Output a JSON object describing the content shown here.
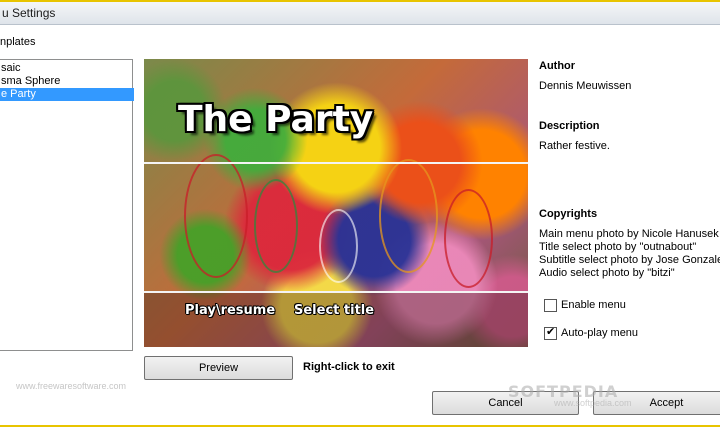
{
  "window": {
    "title": "u Settings"
  },
  "templates": {
    "label": "nplates",
    "items": [
      {
        "label": "saic",
        "selected": false
      },
      {
        "label": "sma Sphere",
        "selected": false
      },
      {
        "label": "e Party",
        "selected": true
      }
    ]
  },
  "preview": {
    "title": "The Party",
    "menu_items": [
      "Play\\resume",
      "Select title"
    ]
  },
  "info": {
    "author_heading": "Author",
    "author": "Dennis Meuwissen",
    "description_heading": "Description",
    "description": "Rather festive.",
    "copyrights_heading": "Copyrights",
    "copyrights": [
      "Main menu photo by Nicole Hanusek",
      "Title select photo by \"outnabout\"",
      "Subtitle select photo by Jose Gonzalez",
      "Audio select photo by \"bitzi\""
    ]
  },
  "options": {
    "enable_menu": {
      "label": "Enable menu",
      "checked": false
    },
    "autoplay_menu": {
      "label": "Auto-play menu",
      "checked": true
    }
  },
  "buttons": {
    "preview": "Preview",
    "cancel": "Cancel",
    "accept": "Accept"
  },
  "hint": "Right-click to exit",
  "watermark": {
    "site": "www.freewaresoftware.com",
    "brand": "SOFTPEDIA",
    "url": "www.softpedia.com"
  },
  "colors": {
    "selection": "#3399ff",
    "accent_stripe": "#e8c400"
  }
}
